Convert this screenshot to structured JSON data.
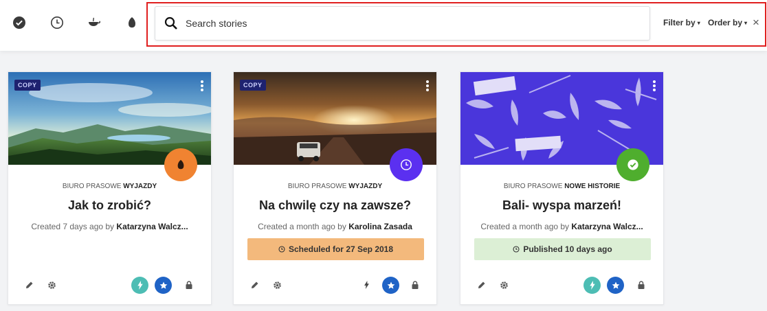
{
  "toolbar": {
    "status_filters": [
      {
        "icon": "check-circle-icon",
        "label": "Published"
      },
      {
        "icon": "clock-icon",
        "label": "Scheduled"
      },
      {
        "icon": "pot-icon",
        "label": "In progress"
      },
      {
        "icon": "seed-icon",
        "label": "Draft"
      }
    ],
    "search": {
      "placeholder": "Search stories",
      "value": ""
    },
    "filter_label": "Filter by",
    "order_label": "Order by",
    "close_symbol": "×"
  },
  "cards": [
    {
      "copy_badge": "COPY",
      "image": "mountain-landscape",
      "status": "draft",
      "status_color": "#f08331",
      "category_prefix": "BIURO PRASOWE",
      "category_name": "WYJAZDY",
      "title": "Jak to zrobić?",
      "created": "Created 7 days ago by",
      "author": "Katarzyna Walcz...",
      "banner": "",
      "actions": {
        "edit": "pencil-icon",
        "settings": "gear-icon",
        "bolt": "bolt-icon",
        "star": "star-icon",
        "lock": "lock-icon"
      },
      "bolt_highlighted": true
    },
    {
      "copy_badge": "COPY",
      "image": "sunset-road",
      "status": "scheduled",
      "status_color": "#5b30f0",
      "category_prefix": "BIURO PRASOWE",
      "category_name": "WYJAZDY",
      "title": "Na chwilę czy na zawsze?",
      "created": "Created a month ago by",
      "author": "Karolina Zasada",
      "banner": "Scheduled for 27 Sep 2018",
      "actions": {
        "edit": "pencil-icon",
        "settings": "gear-icon",
        "bolt": "bolt-icon",
        "star": "star-icon",
        "lock": "lock-icon"
      },
      "bolt_highlighted": false
    },
    {
      "copy_badge": "",
      "image": "feathers-illustration",
      "status": "published",
      "status_color": "#4fae2e",
      "category_prefix": "BIURO PRASOWE",
      "category_name": "NOWE HISTORIE",
      "title": "Bali- wyspa marzeń!",
      "created": "Created a month ago by",
      "author": "Katarzyna Walcz...",
      "banner": "Published 10 days ago",
      "actions": {
        "edit": "pencil-icon",
        "settings": "gear-icon",
        "bolt": "bolt-icon",
        "star": "star-icon",
        "lock": "lock-icon"
      },
      "bolt_highlighted": true
    }
  ],
  "colors": {
    "accent_teal": "#4dbdb4",
    "accent_blue": "#1f63c6",
    "highlight_red": "#e01e1e"
  }
}
